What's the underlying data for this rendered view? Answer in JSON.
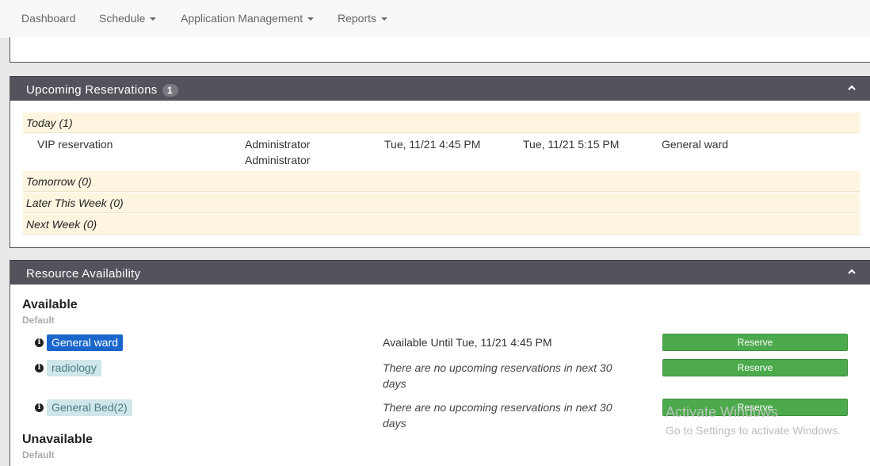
{
  "nav": {
    "dashboard": "Dashboard",
    "schedule": "Schedule",
    "application_management": "Application Management",
    "reports": "Reports"
  },
  "upcoming": {
    "title": "Upcoming Reservations",
    "count": "1",
    "groups": {
      "today": "Today (1)",
      "tomorrow": "Tomorrow (0)",
      "later_this_week": "Later This Week (0)",
      "next_week": "Next Week (0)"
    },
    "reservation": {
      "title": "VIP reservation",
      "user_line1": "Administrator",
      "user_line2": "Administrator",
      "start": "Tue, 11/21 4:45 PM",
      "end": "Tue, 11/21 5:15 PM",
      "resource": "General ward"
    }
  },
  "availability": {
    "title": "Resource Availability",
    "available_heading": "Available",
    "available_group": "Default",
    "unavailable_heading": "Unavailable",
    "unavailable_group": "Default",
    "resources": [
      {
        "name": "General ward",
        "status_line1": "Available Until Tue, 11/21 4:45 PM",
        "status_line2": "",
        "button": "Reserve"
      },
      {
        "name": "radiology",
        "status_line1": "There are no upcoming reservations in next 30",
        "status_line2": "days",
        "button": "Reserve"
      },
      {
        "name": "General Bed(2)",
        "status_line1": "There are no upcoming reservations in next 30",
        "status_line2": "days",
        "button": "Reserve"
      }
    ]
  },
  "watermark": {
    "line1": "Activate Windows",
    "line2": "Go to Settings to activate Windows."
  },
  "colors": {
    "panel_header": "#55525c",
    "group_row": "#fdf5e0",
    "reserve_button": "#4caa4c",
    "tag_available": "#1a66cc",
    "tag_other": "#cfe6ea"
  },
  "icons": [
    "info-icon",
    "chevron-up-icon",
    "caret-down-icon"
  ]
}
